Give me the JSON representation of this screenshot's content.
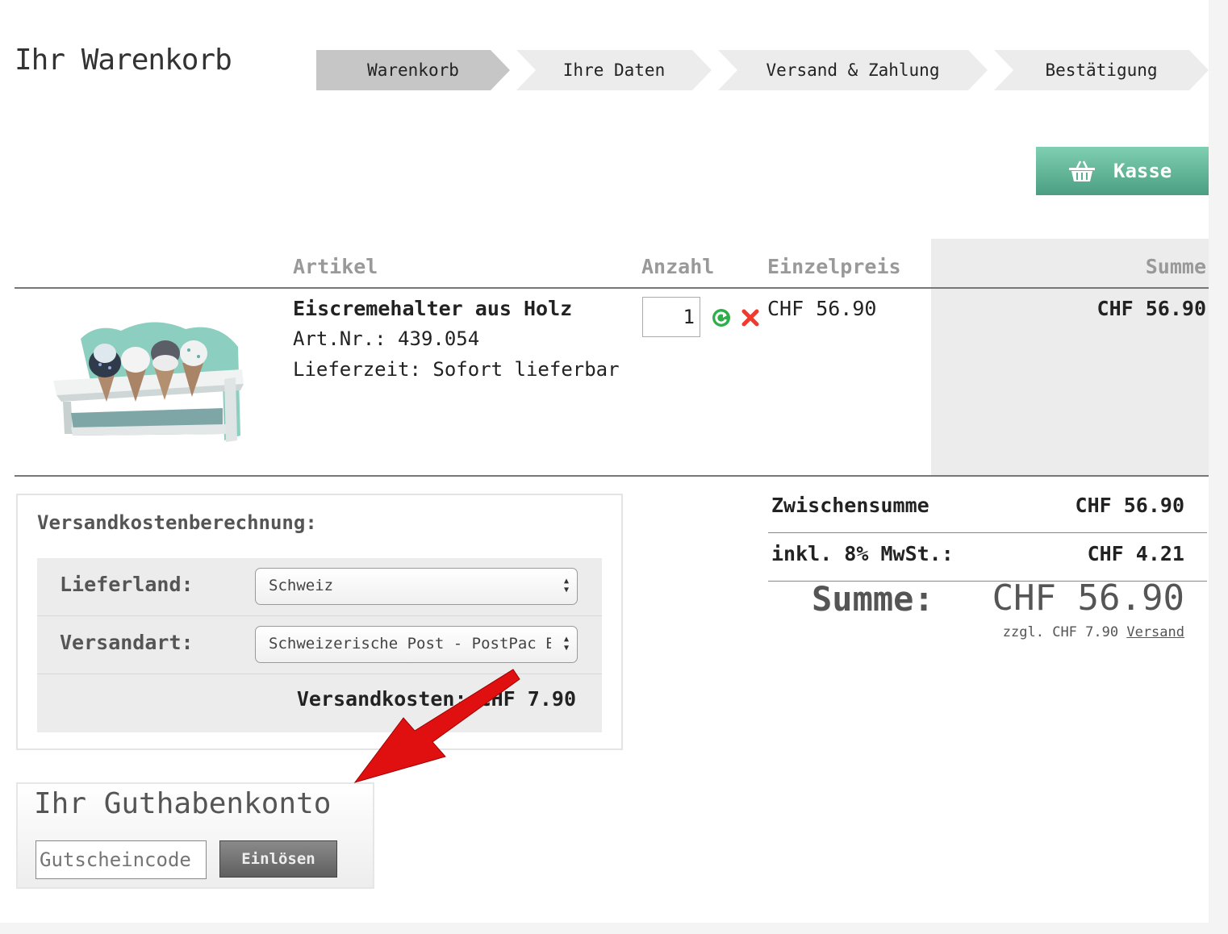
{
  "header": {
    "title": "Ihr Warenkorb"
  },
  "steps": [
    {
      "label": "Warenkorb"
    },
    {
      "label": "Ihre Daten"
    },
    {
      "label": "Versand & Zahlung"
    },
    {
      "label": "Bestätigung"
    }
  ],
  "checkout_button": {
    "label": "Kasse",
    "icon": "basket-icon"
  },
  "table": {
    "columns": {
      "article": "Artikel",
      "quantity": "Anzahl",
      "unit_price": "Einzelpreis",
      "sum": "Summe"
    },
    "item": {
      "name": "Eiscremehalter aus Holz",
      "article_no": "Art.Nr.: 439.054",
      "delivery": "Lieferzeit: Sofort lieferbar",
      "quantity": "1",
      "unit_price": "CHF 56.90",
      "sum": "CHF 56.90"
    }
  },
  "shipping": {
    "title": "Versandkostenberechnung:",
    "country_label": "Lieferland:",
    "country_value": "Schweiz",
    "method_label": "Versandart:",
    "method_value": "Schweizerische Post - PostPac Economy",
    "cost_text": "Versandkosten: CHF 7.90"
  },
  "totals": {
    "subtotal_label": "Zwischensumme",
    "subtotal_value": "CHF 56.90",
    "vat_label": "inkl. 8% MwSt.:",
    "vat_value": "CHF 4.21",
    "total_label": "Summe:",
    "total_value": "CHF 56.90",
    "shipping_note_prefix": "zzgl. CHF 7.90",
    "shipping_note_link": "Versand"
  },
  "credit": {
    "title": "Ihr Guthabenkonto",
    "input_placeholder": "Gutscheincode",
    "button_label": "Einlösen"
  },
  "colors": {
    "accent_green": "#5fb597",
    "annotation_red": "#e01010"
  }
}
